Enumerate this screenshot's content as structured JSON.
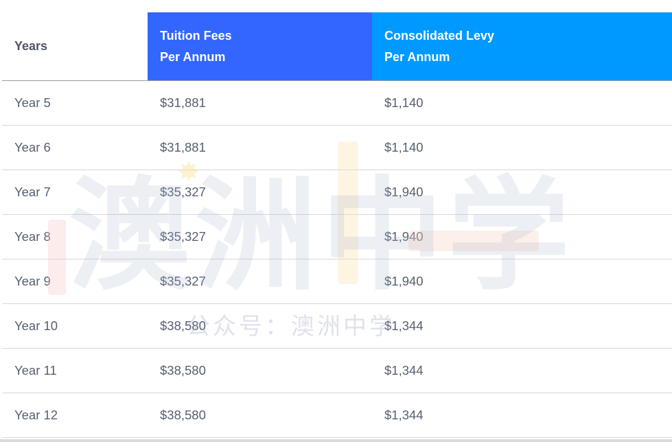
{
  "table": {
    "headers": {
      "years": "Years",
      "tuition_line1": "Tuition Fees",
      "tuition_line2": "Per Annum",
      "levy_line1": "Consolidated Levy",
      "levy_line2": "Per Annum"
    },
    "rows": [
      {
        "year": "Year 5",
        "tuition": "$31,881",
        "levy": "$1,140"
      },
      {
        "year": "Year 6",
        "tuition": "$31,881",
        "levy": "$1,140"
      },
      {
        "year": "Year 7",
        "tuition": "$35,327",
        "levy": "$1,940"
      },
      {
        "year": "Year 8",
        "tuition": "$35,327",
        "levy": "$1,940"
      },
      {
        "year": "Year 9",
        "tuition": "$35,327",
        "levy": "$1,940"
      },
      {
        "year": "Year 10",
        "tuition": "$38,580",
        "levy": "$1,344"
      },
      {
        "year": "Year 11",
        "tuition": "$38,580",
        "levy": "$1,344"
      },
      {
        "year": "Year 12",
        "tuition": "$38,580",
        "levy": "$1,344"
      }
    ]
  },
  "watermark": {
    "main": "澳洲中学",
    "sub": "公众号：澳洲中学"
  },
  "colors": {
    "tuition_header_bg": "#3366ff",
    "levy_header_bg": "#0099ff",
    "body_text": "#566071"
  }
}
